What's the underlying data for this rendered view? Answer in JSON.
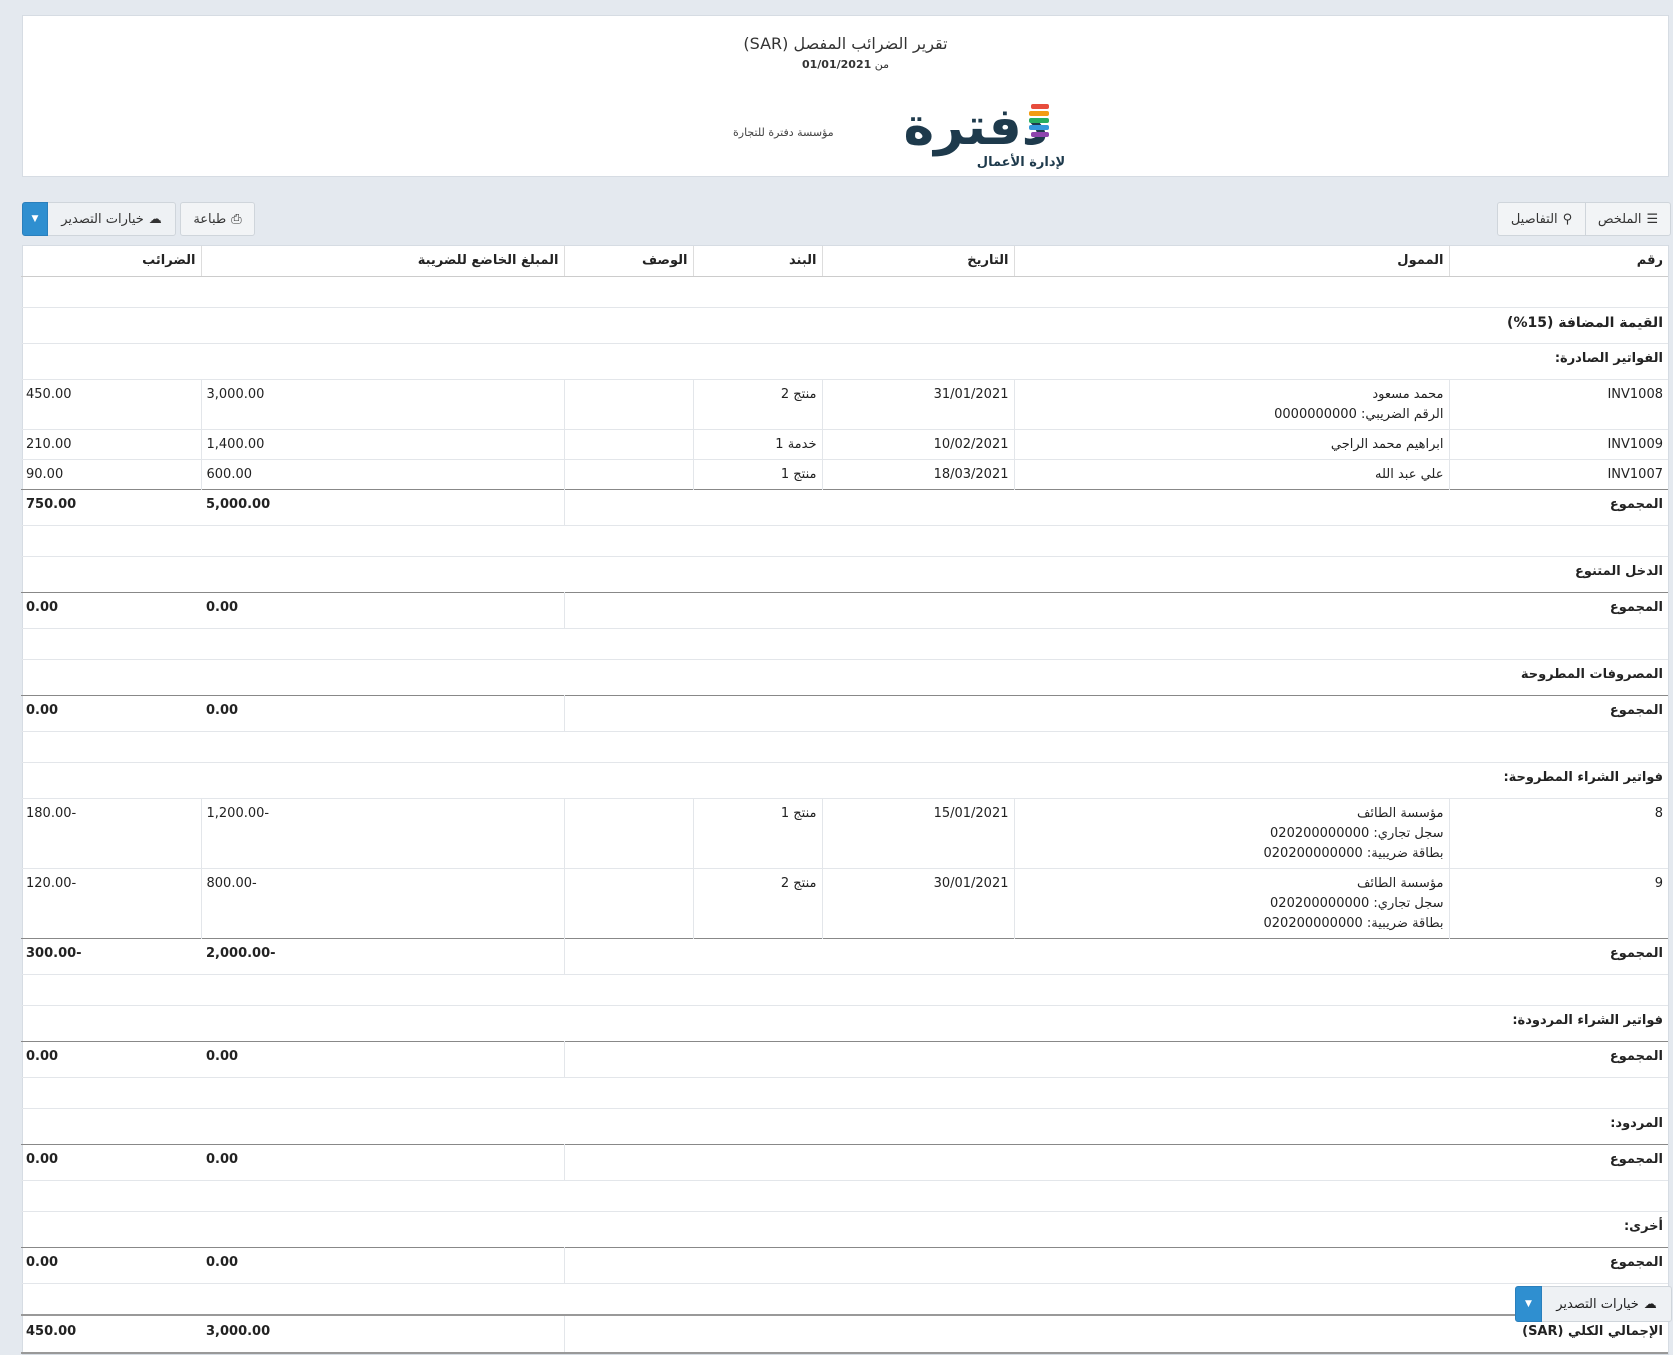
{
  "header": {
    "title": "تقرير الضرائب المفصل (SAR)",
    "period_prefix": "من",
    "period_date": "01/01/2021",
    "company_name": "مؤسسة دفترة للتجارة",
    "logo_text": "دفترة",
    "logo_tagline": "لإدارة الأعمال"
  },
  "toolbar": {
    "summary_label": "الملخص",
    "details_label": "التفاصيل",
    "print_label": "طباعة",
    "export_label": "خيارات التصدير"
  },
  "columns": {
    "number": "رقم",
    "taxpayer": "الممول",
    "date": "التاريخ",
    "item": "البند",
    "description": "الوصف",
    "taxable_amount": "المبلغ الخاضع للضريبة",
    "taxes": "الضرائب"
  },
  "total_label": "المجموع",
  "vat_section": "القيمة المضافة (15%)",
  "issued_invoices": {
    "title": "الفواتير الصادرة:",
    "rows": [
      {
        "number": "INV1008",
        "taxpayer": "محمد مسعود",
        "taxpayer_extra": [
          "الرقم الضريبي: 0000000000"
        ],
        "date": "31/01/2021",
        "item": "منتج 2",
        "description": "",
        "taxable": "3,000.00",
        "tax": "450.00"
      },
      {
        "number": "INV1009",
        "taxpayer": "ابراهيم محمد الراجي",
        "taxpayer_extra": [],
        "date": "10/02/2021",
        "item": "خدمة 1",
        "description": "",
        "taxable": "1,400.00",
        "tax": "210.00"
      },
      {
        "number": "INV1007",
        "taxpayer": "علي عبد الله",
        "taxpayer_extra": [],
        "date": "18/03/2021",
        "item": "منتج 1",
        "description": "",
        "taxable": "600.00",
        "tax": "90.00"
      }
    ],
    "total_taxable": "5,000.00",
    "total_tax": "750.00"
  },
  "misc_income": {
    "title": "الدخل المتنوع",
    "total_taxable": "0.00",
    "total_tax": "0.00"
  },
  "deducted_expenses": {
    "title": "المصروفات المطروحة",
    "total_taxable": "0.00",
    "total_tax": "0.00"
  },
  "purchase_invoices": {
    "title": "فواتير الشراء المطروحة:",
    "rows": [
      {
        "number": "8",
        "taxpayer": "مؤسسة الطائف",
        "taxpayer_extra": [
          "سجل تجاري: 020200000000",
          "بطاقة ضريبية: 020200000000"
        ],
        "date": "15/01/2021",
        "item": "منتج 1",
        "description": "",
        "taxable": "-1,200.00",
        "tax": "-180.00"
      },
      {
        "number": "9",
        "taxpayer": "مؤسسة الطائف",
        "taxpayer_extra": [
          "سجل تجاري: 020200000000",
          "بطاقة ضريبية: 020200000000"
        ],
        "date": "30/01/2021",
        "item": "منتج 2",
        "description": "",
        "taxable": "-800.00",
        "tax": "-120.00"
      }
    ],
    "total_taxable": "-2,000.00",
    "total_tax": "-300.00"
  },
  "purchase_returns": {
    "title": "فواتير الشراء المردودة:",
    "total_taxable": "0.00",
    "total_tax": "0.00"
  },
  "returns": {
    "title": "المردود:",
    "total_taxable": "0.00",
    "total_tax": "0.00"
  },
  "other": {
    "title": "أخرى:",
    "total_taxable": "0.00",
    "total_tax": "0.00"
  },
  "grand_total": {
    "label": "الإجمالي الكلي (SAR)",
    "taxable": "3,000.00",
    "tax": "450.00"
  },
  "colors": {
    "accent": "#2f8fd0",
    "background": "#e4e9ef"
  },
  "icons": {
    "summary": "list-icon",
    "details": "search-icon",
    "print": "printer-icon",
    "export": "cloud-download-icon",
    "caret": "caret-down-icon"
  }
}
